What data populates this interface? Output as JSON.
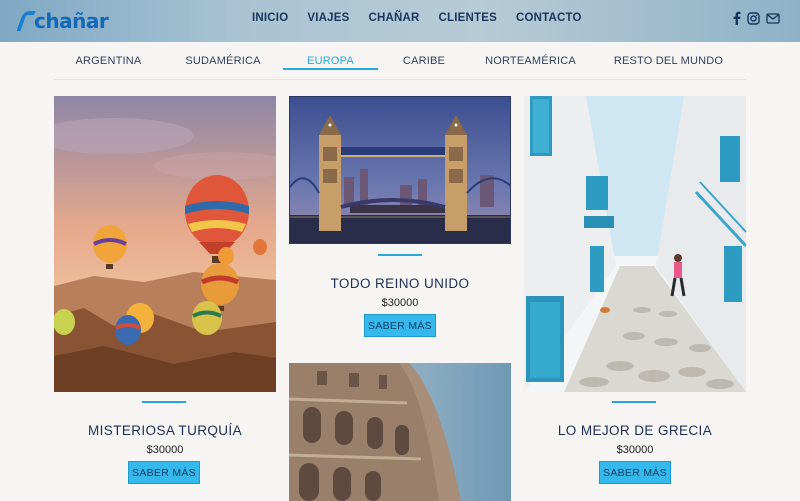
{
  "header": {
    "logo_text": "chañar",
    "nav": [
      "INICIO",
      "VIAJES",
      "CHAÑAR",
      "CLIENTES",
      "CONTACTO"
    ],
    "social_icons": [
      "facebook-icon",
      "instagram-icon",
      "mail-icon"
    ]
  },
  "tabs": {
    "items": [
      "ARGENTINA",
      "SUDAMÉRICA",
      "EUROPA",
      "CARIBE",
      "NORTEAMÉRICA",
      "RESTO DEL MUNDO"
    ],
    "active": "EUROPA"
  },
  "cards": [
    {
      "title": "MISTERIOSA TURQUÍA",
      "price": "$30000",
      "button": "SABER MÁS"
    },
    {
      "title": "TODO REINO UNIDO",
      "price": "$30000",
      "button": "SABER MÁS"
    },
    {
      "title": "LO MEJOR DE GRECIA",
      "price": "$30000",
      "button": "SABER MÁS"
    }
  ],
  "colors": {
    "accent": "#2aa6d9",
    "button": "#35b8ec",
    "title": "#1e2f55"
  }
}
